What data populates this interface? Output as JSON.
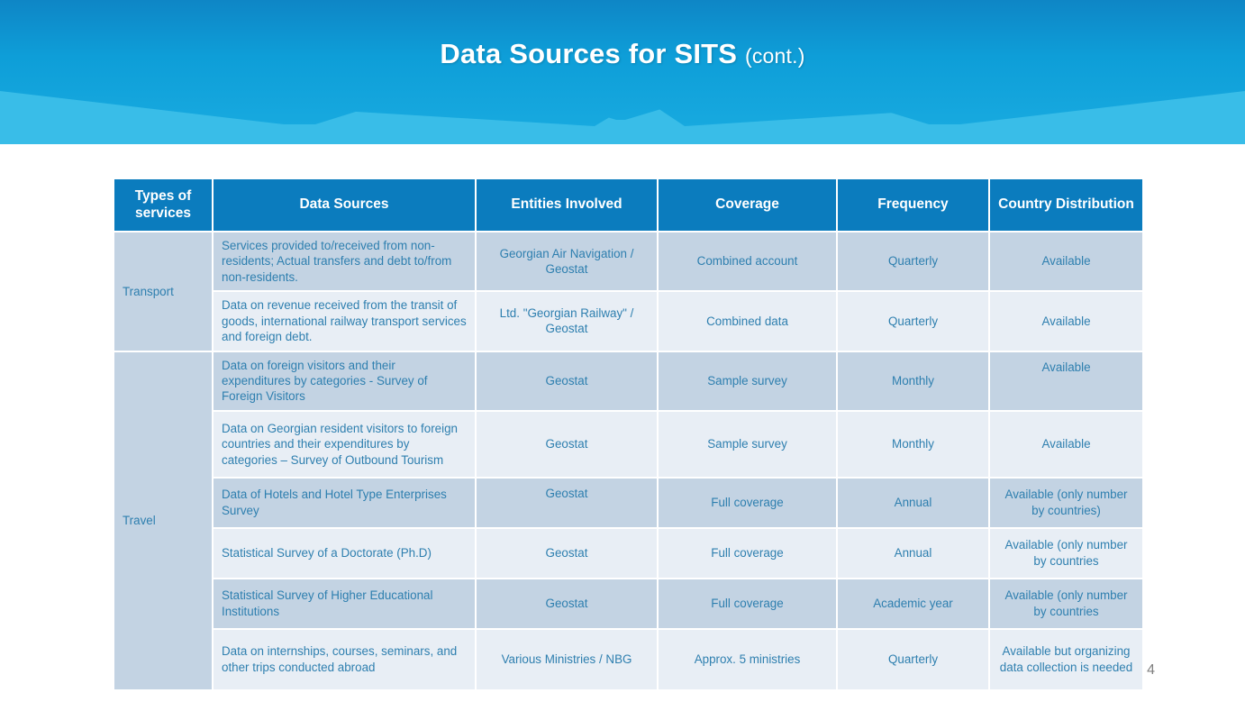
{
  "slide": {
    "title_main": "Data Sources for SITS ",
    "title_cont": "(cont.)",
    "page_number": "4",
    "colors": {
      "header_blue": "#0B7CBE",
      "band_dark": "#C3D3E3",
      "band_light": "#E8EEF5",
      "body_text": "#2E7FAF",
      "availability_text": "#E3536A"
    }
  },
  "table": {
    "headers": [
      "Types of services",
      "Data Sources",
      "Entities Involved",
      "Coverage",
      "Frequency",
      "Country Distribution"
    ],
    "header_types_of_services": "Types of services",
    "header_data_sources": "Data Sources",
    "header_entities_involved": "Entities Involved",
    "header_coverage": "Coverage",
    "header_frequency": "Frequency",
    "header_country_distribution": "Country Distribution",
    "categories": {
      "transport": "Transport",
      "travel": "Travel"
    },
    "rows": [
      {
        "category": "Transport",
        "data_source": "Services provided to/received from non-residents; Actual transfers  and debt to/from non-residents.",
        "entities_involved": "Georgian Air Navigation / Geostat",
        "coverage": "Combined account",
        "frequency": "Quarterly",
        "country_distribution": "Available"
      },
      {
        "category": "Transport",
        "data_source": "Data on revenue received from the transit of goods, international railway transport services and foreign debt.",
        "entities_involved": "Ltd. \"Georgian Railway\" / Geostat",
        "coverage": "Combined data",
        "frequency": "Quarterly",
        "country_distribution": "Available"
      },
      {
        "category": "Travel",
        "data_source": "Data on foreign visitors and their expenditures by categories - Survey of Foreign Visitors",
        "entities_involved": "Geostat",
        "coverage": "Sample survey",
        "frequency": "Monthly",
        "country_distribution": "Available"
      },
      {
        "category": "Travel",
        "data_source": "Data on Georgian resident visitors to foreign countries and their expenditures by categories – Survey of Outbound Tourism",
        "entities_involved": "Geostat",
        "coverage": "Sample survey",
        "frequency": "Monthly",
        "country_distribution": "Available"
      },
      {
        "category": "Travel",
        "data_source": "Data of Hotels and Hotel Type Enterprises Survey",
        "entities_involved": "Geostat",
        "coverage": "Full coverage",
        "frequency": "Annual",
        "country_distribution": "Available (only number by countries)"
      },
      {
        "category": "Travel",
        "data_source": "Statistical Survey of a Doctorate (Ph.D)",
        "entities_involved": "Geostat",
        "coverage": "Full coverage",
        "frequency": "Annual",
        "country_distribution": "Available (only number by countries"
      },
      {
        "category": "Travel",
        "data_source": "Statistical Survey of Higher Educational Institutions",
        "entities_involved": "Geostat",
        "coverage": "Full coverage",
        "frequency": "Academic year",
        "country_distribution": "Available (only number by countries"
      },
      {
        "category": "Travel",
        "data_source": "Data on internships, courses, seminars, and other trips conducted abroad",
        "entities_involved": "Various Ministries / NBG",
        "coverage": "Approx. 5 ministries",
        "frequency": "Quarterly",
        "country_distribution": "Available but organizing data collection is needed"
      }
    ]
  }
}
